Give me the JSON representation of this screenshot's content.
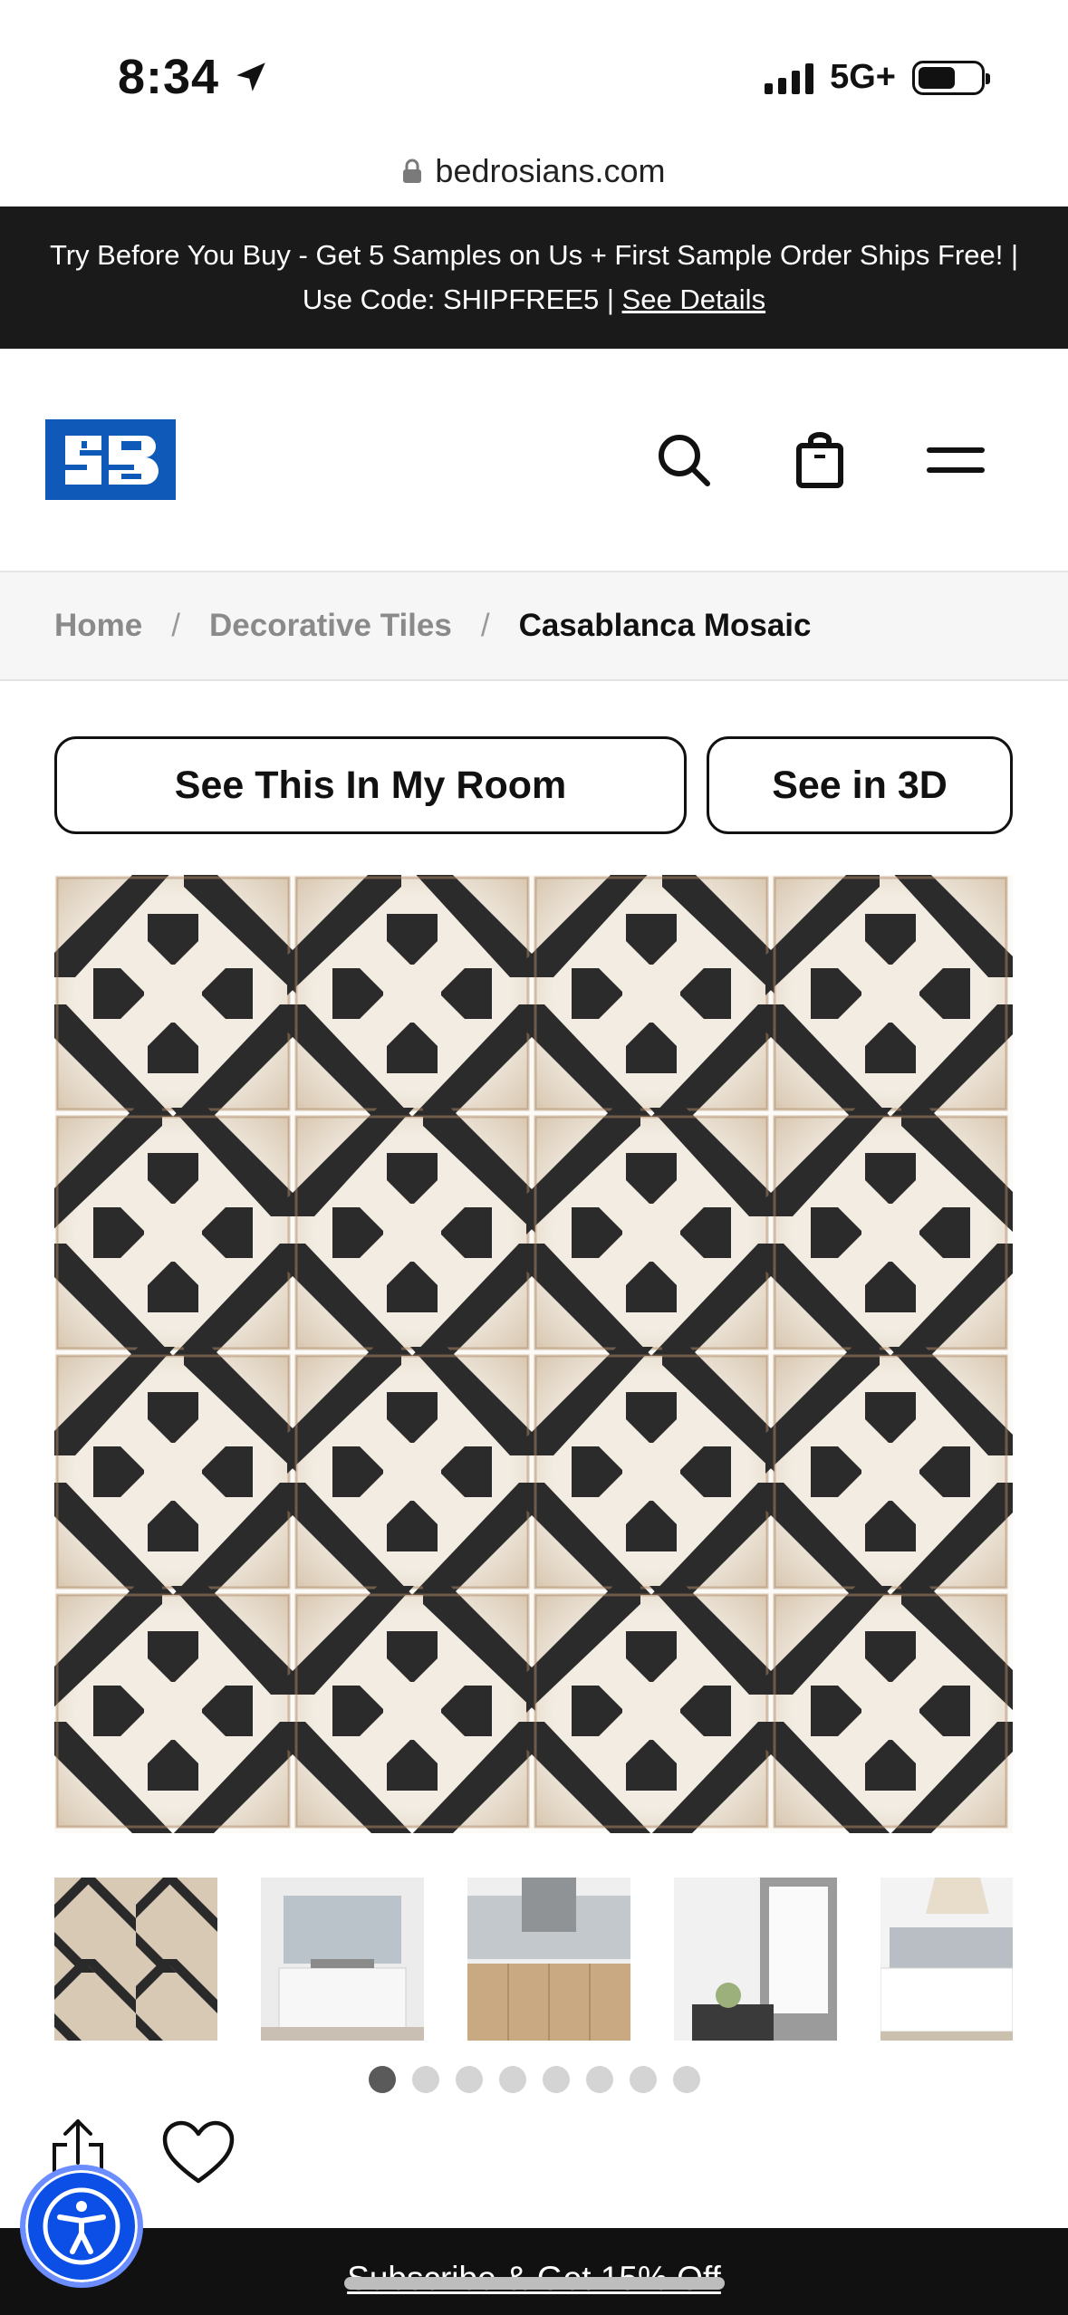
{
  "status_bar": {
    "time": "8:34",
    "network": "5G+"
  },
  "browser": {
    "url": "bedrosians.com"
  },
  "promo": {
    "line1": "Try Before You Buy - Get 5 Samples on Us + First Sample Order Ships Free! |",
    "line2_prefix": "Use Code: SHIPFREE5 | ",
    "link": "See Details"
  },
  "header": {
    "logo": "bedrosians-logo",
    "icons": [
      "search-icon",
      "shopping-bag-icon",
      "menu-icon"
    ]
  },
  "breadcrumb": {
    "items": [
      "Home",
      "Decorative Tiles"
    ],
    "current": "Casablanca Mosaic",
    "separator": "/"
  },
  "actions": {
    "room_button": "See This In My Room",
    "three_d_button": "See in 3D"
  },
  "gallery": {
    "thumbnail_count": 5,
    "dot_count": 8,
    "active_dot": 1,
    "colors": {
      "tile_ink": "#2b2b2b",
      "tile_base": "#efe8de",
      "grout": "#fbfaf6"
    }
  },
  "footer": {
    "subscribe": "Subscribe & Get 15% Off",
    "accessibility_icon": "accessibility-icon"
  }
}
